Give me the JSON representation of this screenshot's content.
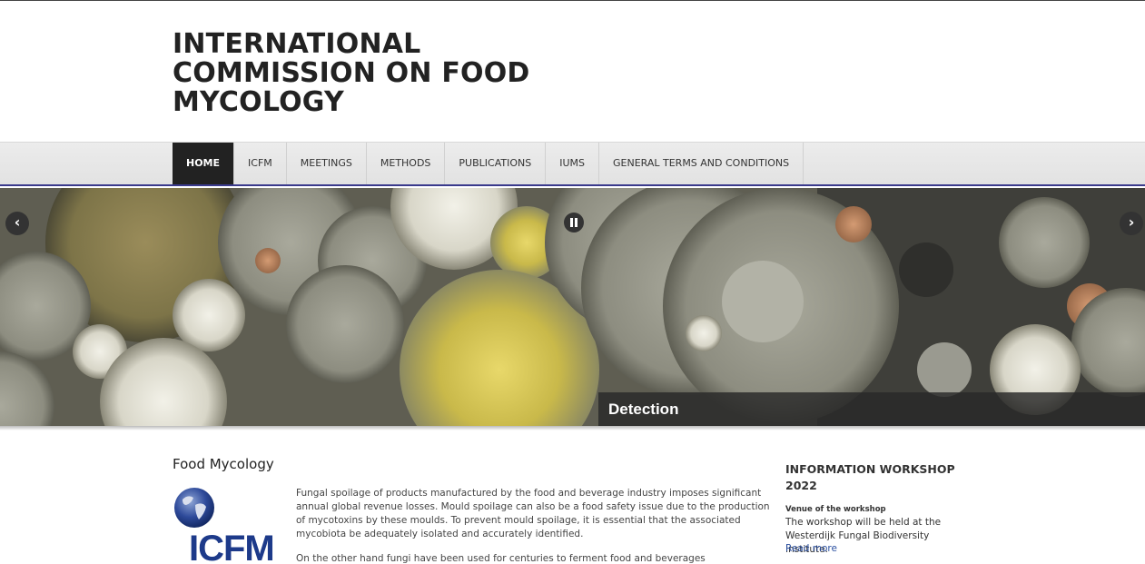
{
  "header": {
    "title_line1": "INTERNATIONAL",
    "title_line2": "COMMISSION ON FOOD",
    "title_line3": "MYCOLOGY"
  },
  "nav": {
    "items": [
      {
        "label": "HOME",
        "active": true
      },
      {
        "label": "ICFM",
        "active": false
      },
      {
        "label": "MEETINGS",
        "active": false
      },
      {
        "label": "METHODS",
        "active": false
      },
      {
        "label": "PUBLICATIONS",
        "active": false
      },
      {
        "label": "IUMS",
        "active": false
      },
      {
        "label": "GENERAL TERMS AND CONDITIONS",
        "active": false
      }
    ]
  },
  "slider": {
    "caption": "Detection",
    "prev_icon": "chevron-left-icon",
    "next_icon": "chevron-right-icon",
    "pause_icon": "pause-icon"
  },
  "main": {
    "heading": "Food Mycology",
    "logo_text": "ICFM",
    "paragraph1": "Fungal spoilage of products manufactured by the food and beverage industry imposes significant annual global revenue losses.  Mould spoilage can also be a food safety issue due to the production of mycotoxins by these moulds. To prevent mould spoilage, it is essential that the associated mycobiota be adequately isolated and accurately identified.",
    "paragraph2": "On the other hand fungi have been used for centuries to ferment food and beverages demonstrating the"
  },
  "sidebar": {
    "heading": "INFORMATION WORKSHOP 2022",
    "venue_label": "Venue of the workshop",
    "venue_text": "The workshop will be held at the Westerdijk Fungal Biodiversity Institute.",
    "read_more": "Read more"
  },
  "colors": {
    "nav_active_bg": "#222222",
    "nav_border": "#3a3a8c",
    "link": "#2a4fa0",
    "logo_blue": "#1d3a8a"
  }
}
